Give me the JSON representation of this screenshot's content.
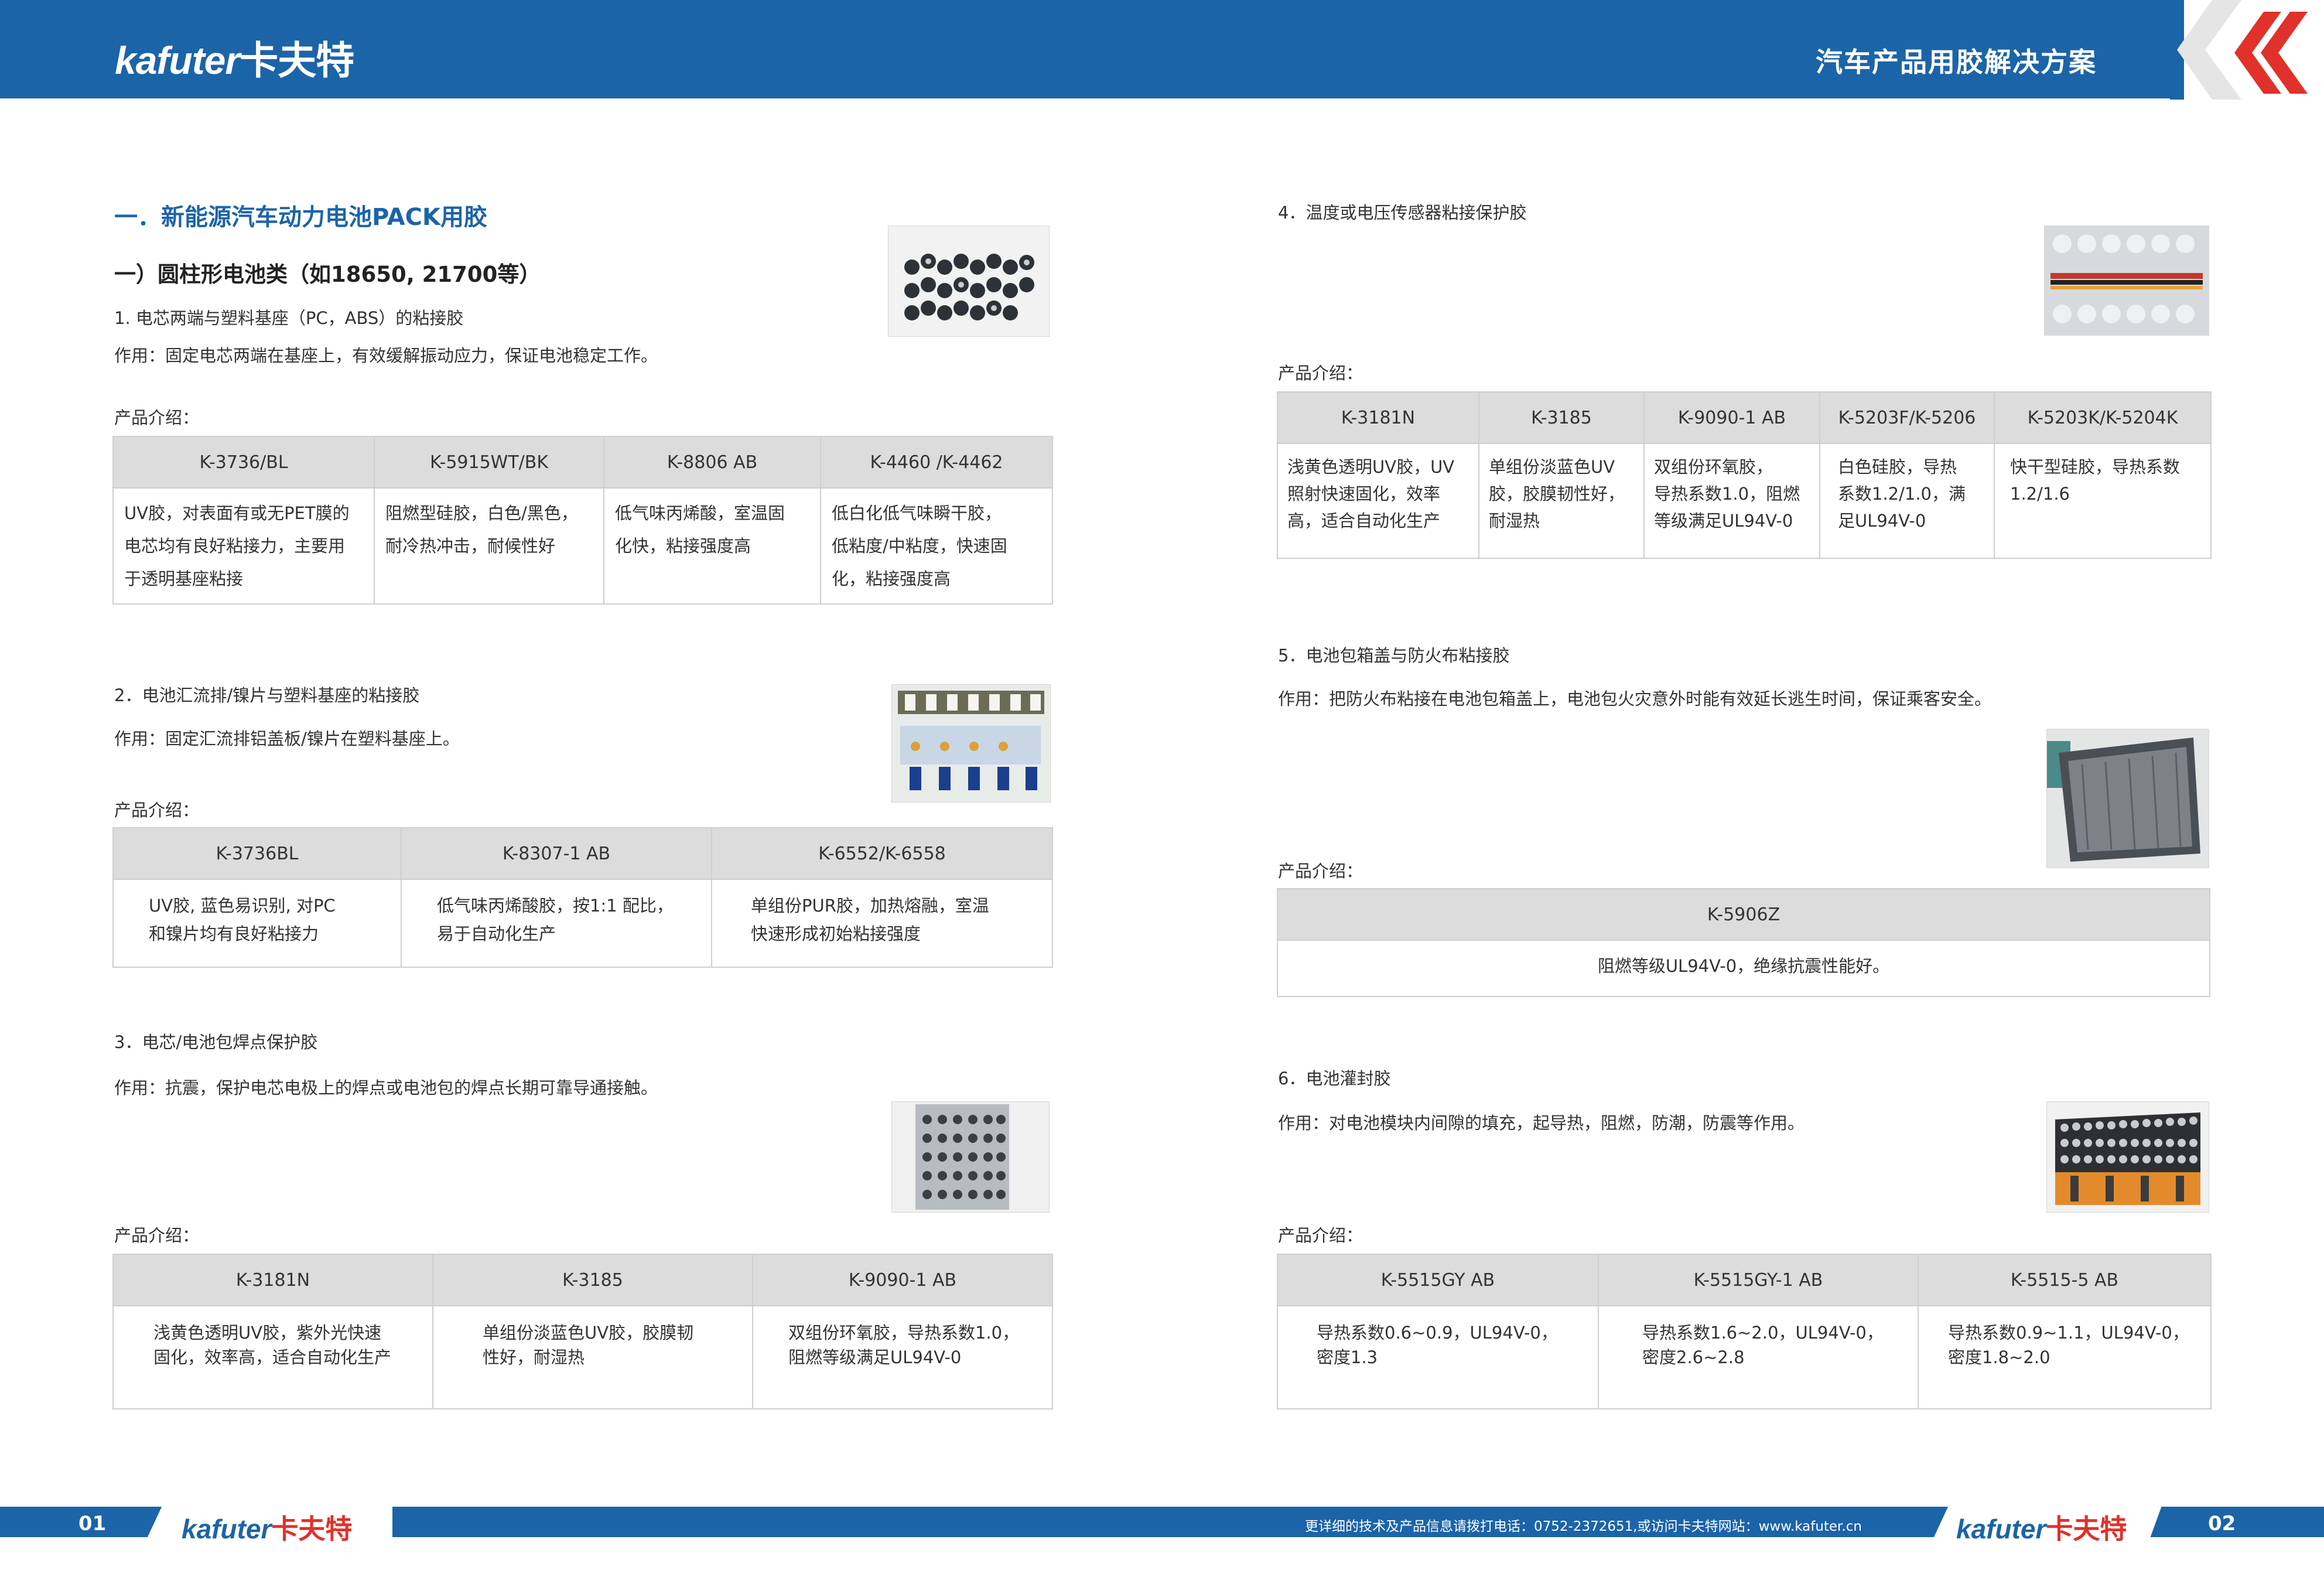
{
  "header": {
    "logo_en": "kafuter",
    "logo_cn": "卡夫特",
    "title": "汽车产品用胶解决方案",
    "accent_color": "#1c64a8",
    "chevron_color": "#e0312a"
  },
  "left": {
    "section_title": "一．新能源汽车动力电池PACK用胶",
    "subsection_title": "一）圆柱形电池类（如18650, 21700等）",
    "items": [
      {
        "heading": "1. 电芯两端与塑料基座（PC，ABS）的粘接胶",
        "usage": "作用：固定电芯两端在基座上，有效缓解振动应力，保证电池稳定工作。",
        "product_label": "产品介绍：",
        "columns": [
          "K-3736/BL",
          "K-5915WT/BK",
          "K-8806 AB",
          "K-4460 /K-4462"
        ],
        "cells": [
          [
            "UV胶，对表面有或无PET膜的",
            "电芯均有良好粘接力，主要用",
            "于透明基座粘接"
          ],
          [
            "阻燃型硅胶，白色/黑色，",
            "耐冷热冲击，耐候性好"
          ],
          [
            "低气味丙烯酸，室温固",
            "化快，粘接强度高"
          ],
          [
            "低白化低气味瞬干胶，",
            "低粘度/中粘度，快速固",
            "化，粘接强度高"
          ]
        ]
      },
      {
        "heading": "2．电池汇流排/镍片与塑料基座的粘接胶",
        "usage": "作用：固定汇流排铝盖板/镍片在塑料基座上。",
        "product_label": "产品介绍：",
        "columns": [
          "K-3736BL",
          "K-8307-1 AB",
          "K-6552/K-6558"
        ],
        "cells": [
          [
            "UV胶, 蓝色易识别, 对PC",
            "和镍片均有良好粘接力"
          ],
          [
            "低气味丙烯酸胶，按1:1 配比，",
            "易于自动化生产"
          ],
          [
            "单组份PUR胶，加热熔融，室温",
            "快速形成初始粘接强度"
          ]
        ]
      },
      {
        "heading": "3．电芯/电池包焊点保护胶",
        "usage": "作用：抗震，保护电芯电极上的焊点或电池包的焊点长期可靠导通接触。",
        "product_label": "产品介绍：",
        "columns": [
          "K-3181N",
          "K-3185",
          "K-9090-1 AB"
        ],
        "cells": [
          [
            "浅黄色透明UV胶，紫外光快速",
            "固化，效率高，适合自动化生产"
          ],
          [
            "单组份淡蓝色UV胶，胶膜韧",
            "性好，耐湿热"
          ],
          [
            "双组份环氧胶，导热系数1.0，",
            "阻燃等级满足UL94V-0"
          ]
        ]
      }
    ]
  },
  "right": {
    "items": [
      {
        "heading": "4．温度或电压传感器粘接保护胶",
        "product_label": "产品介绍：",
        "columns": [
          "K-3181N",
          "K-3185",
          "K-9090-1 AB",
          "K-5203F/K-5206",
          "K-5203K/K-5204K"
        ],
        "cells": [
          [
            "浅黄色透明UV胶，UV",
            "照射快速固化，效率",
            "高，适合自动化生产"
          ],
          [
            "单组份淡蓝色UV",
            "胶，胶膜韧性好，",
            "耐湿热"
          ],
          [
            "双组份环氧胶，",
            "导热系数1.0，阻燃",
            "等级满足UL94V-0"
          ],
          [
            "白色硅胶，导热",
            "系数1.2/1.0，满",
            "足UL94V-0"
          ],
          [
            "快干型硅胶，导热系数",
            "1.2/1.6"
          ]
        ]
      },
      {
        "heading": "5．电池包箱盖与防火布粘接胶",
        "usage": "作用：把防火布粘接在电池包箱盖上，电池包火灾意外时能有效延长逃生时间，保证乘客安全。",
        "product_label": "产品介绍：",
        "columns": [
          "K-5906Z"
        ],
        "cells": [
          [
            "阻燃等级UL94V-0，绝缘抗震性能好。"
          ]
        ]
      },
      {
        "heading": "6．电池灌封胶",
        "usage": "作用：对电池模块内间隙的填充，起导热，阻燃，防潮，防震等作用。",
        "product_label": "产品介绍：",
        "columns": [
          "K-5515GY AB",
          "K-5515GY-1 AB",
          "K-5515-5 AB"
        ],
        "cells": [
          [
            "导热系数0.6~0.9，UL94V-0，",
            "密度1.3"
          ],
          [
            "导热系数1.6~2.0，UL94V-0，",
            "密度2.6~2.8"
          ],
          [
            "导热系数0.9~1.1，UL94V-0，",
            "密度1.8~2.0"
          ]
        ]
      }
    ]
  },
  "footer": {
    "page_left": "01",
    "page_right": "02",
    "contact": "更详细的技术及产品信息请拨打电话：0752-2372651,或访问卡夫特网站：www.kafuter.cn",
    "logo_en": "kafuter",
    "logo_cn": "卡夫特"
  }
}
